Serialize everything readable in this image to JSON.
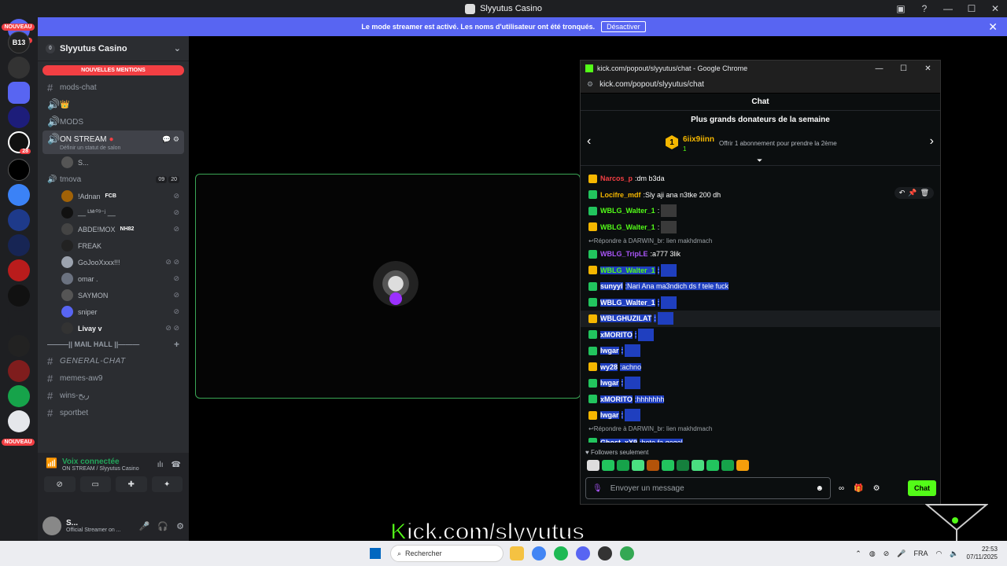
{
  "window": {
    "title": "Slyyutus Casino"
  },
  "banner": {
    "text": "Le mode streamer est activé. Les noms d'utilisateur ont été tronqués.",
    "button": "Désactiver"
  },
  "servers": {
    "badge_top": "40",
    "new_label_top": "NOUVEAU",
    "new_label_bottom": "NOUVEAU",
    "logo_text": "B13",
    "badge_28": "28"
  },
  "guild": {
    "name": "Slyyutus Casino",
    "count": "0"
  },
  "mentions_label": "NOUVELLES MENTIONS",
  "channels": {
    "mods_chat": "mods-chat",
    "crown_channel": "👑",
    "mods": "MODS",
    "on_stream": "ON STREAM",
    "on_stream_status": "Définir un statut de salon",
    "voice_user_s": "S...",
    "category_tmova": "tmova",
    "tmova_count_a": "09",
    "tmova_count_b": "20",
    "mailhall": "———|| MAIL HALL ||———",
    "general_chat": "GENERAL-CHAT",
    "memes": "memes-aw9",
    "wins": "wins-ربح",
    "sportbet": "sportbet"
  },
  "voice_users": [
    {
      "name": "!Adnan",
      "tag": "FCB"
    },
    {
      "name": "__ ᴸᴹʳ⁰³⁻ʲ __",
      "tag": ""
    },
    {
      "name": "ABDE!MOX",
      "tag": "NH82"
    },
    {
      "name": "FREAK",
      "tag": ""
    },
    {
      "name": "GoJooXxxx!!!",
      "tag": ""
    },
    {
      "name": "omar .",
      "tag": ""
    },
    {
      "name": "SAYMON",
      "tag": ""
    },
    {
      "name": "sniper",
      "tag": ""
    },
    {
      "name": "Livay v",
      "tag": ""
    }
  ],
  "voice_panel": {
    "status": "Voix connectée",
    "location": "ON STREAM / Slyyutus Casino"
  },
  "user": {
    "name": "S...",
    "status": "Official Streamer on ..."
  },
  "chrome": {
    "title": "kick.com/popout/slyyutus/chat - Google Chrome",
    "url": "kick.com/popout/slyyutus/chat"
  },
  "chat": {
    "header": "Chat",
    "donors_title": "Plus grands donateurs de la semaine",
    "donor_rank": "1",
    "donor_name": "6iix9iinn",
    "donor_count": "1",
    "donor_offer": "Offrir 1 abonnement pour prendre la 2ème",
    "followers_only": "Followers seulement",
    "input_placeholder": "Envoyer un message",
    "send_button": "Chat"
  },
  "messages": [
    {
      "type": "msg",
      "user": "Narcos_p",
      "color": "#f23f43",
      "text": "dm b3da",
      "selected": false
    },
    {
      "type": "msg",
      "user": "Locifre_mdf",
      "color": "#f5b700",
      "text": "Sly aji ana n3tke 200 dh",
      "selected": false
    },
    {
      "type": "msg",
      "user": "WBLG_Walter_1",
      "color": "#53fc18",
      "text": "",
      "selected": false
    },
    {
      "type": "msg",
      "user": "WBLG_Walter_1",
      "color": "#53fc18",
      "text": "",
      "selected": false
    },
    {
      "type": "reply",
      "text": "Répondre à DARWIN_br: lien makhdmach"
    },
    {
      "type": "msg",
      "user": "WBLG_TripLE",
      "color": "#a855f7",
      "text": "a777 3lik",
      "selected": false
    },
    {
      "type": "msg",
      "user": "WBLG_Walter_1",
      "color": "#53fc18",
      "text": "",
      "selected": true
    },
    {
      "type": "msg",
      "user": "sunyyl",
      "color": "#fff",
      "text": "Nari Ana ma3ndich ds f tele fuck",
      "selected": true
    },
    {
      "type": "msg",
      "user": "WBLG_Walter_1",
      "color": "#fff",
      "text": "",
      "selected": true
    },
    {
      "type": "msg",
      "user": "WBLGHUZILAT",
      "color": "#fff",
      "text": "",
      "selected": true
    },
    {
      "type": "msg",
      "user": "xMORITO",
      "color": "#fff",
      "text": "",
      "selected": true
    },
    {
      "type": "msg",
      "user": "lwgar",
      "color": "#fff",
      "text": "",
      "selected": true
    },
    {
      "type": "msg",
      "user": "wy28",
      "color": "#fff",
      "text": "achno",
      "selected": true
    },
    {
      "type": "msg",
      "user": "lwgar",
      "color": "#fff",
      "text": "",
      "selected": true
    },
    {
      "type": "msg",
      "user": "xMORITO",
      "color": "#fff",
      "text": "hhhhhhh",
      "selected": true
    },
    {
      "type": "msg",
      "user": "lwgar",
      "color": "#fff",
      "text": "",
      "selected": true
    },
    {
      "type": "reply",
      "text": "Répondre à DARWIN_br: lien makhdmach"
    },
    {
      "type": "msg",
      "user": "Ghost_xX9",
      "color": "#fff",
      "text": "hoto fa gogel",
      "selected": true
    }
  ],
  "overlay": {
    "k": "K",
    "rest": "ick.com/slyyutus"
  },
  "taskbar": {
    "search": "Rechercher",
    "lang": "FRA",
    "time": "22:53",
    "date": "07/11/2025"
  },
  "colors": {
    "kick_green": "#53fc18",
    "discord_blurple": "#5865f2",
    "selection_blue": "#1f3fbf"
  }
}
